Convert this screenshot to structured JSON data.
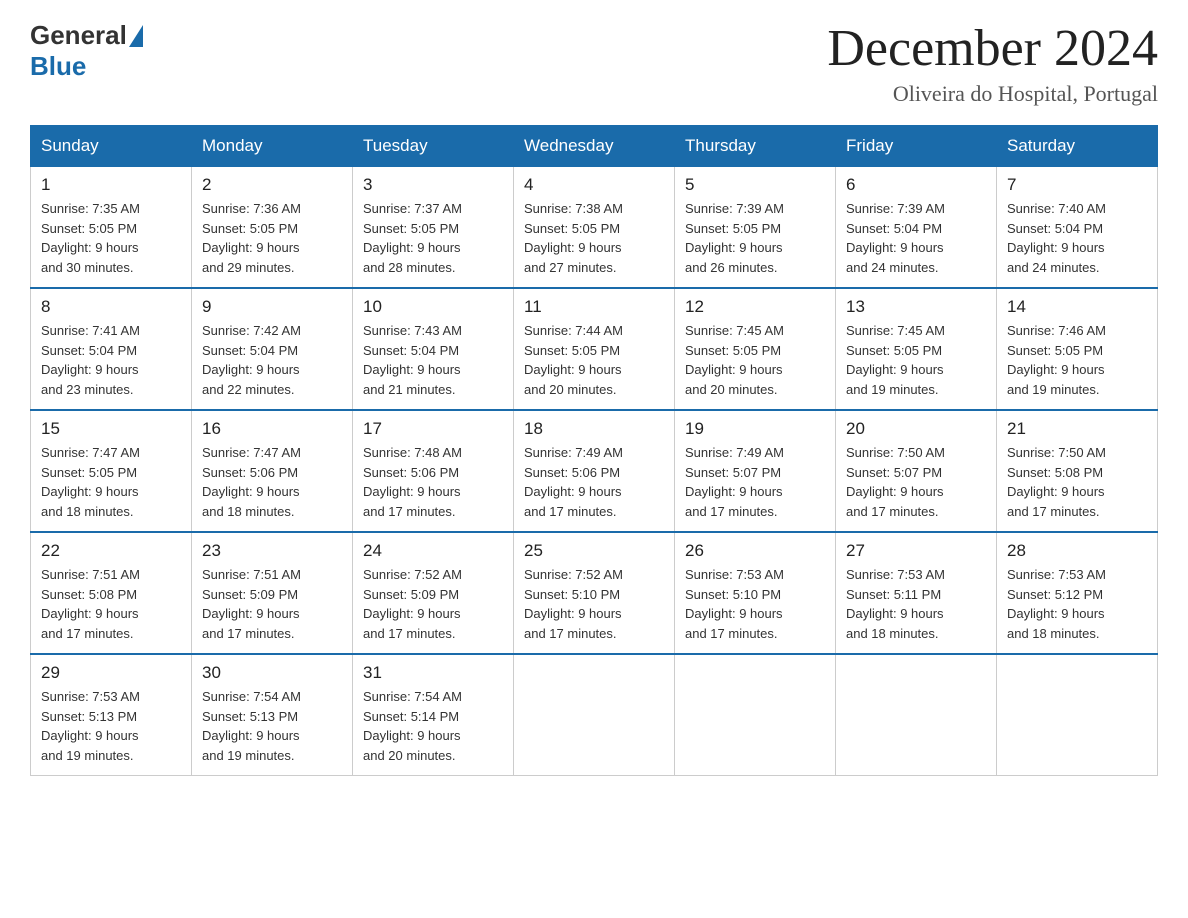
{
  "header": {
    "logo_text_general": "General",
    "logo_text_blue": "Blue",
    "month_title": "December 2024",
    "location": "Oliveira do Hospital, Portugal"
  },
  "weekdays": [
    "Sunday",
    "Monday",
    "Tuesday",
    "Wednesday",
    "Thursday",
    "Friday",
    "Saturday"
  ],
  "weeks": [
    [
      {
        "day": "1",
        "sunrise": "7:35 AM",
        "sunset": "5:05 PM",
        "daylight": "9 hours and 30 minutes."
      },
      {
        "day": "2",
        "sunrise": "7:36 AM",
        "sunset": "5:05 PM",
        "daylight": "9 hours and 29 minutes."
      },
      {
        "day": "3",
        "sunrise": "7:37 AM",
        "sunset": "5:05 PM",
        "daylight": "9 hours and 28 minutes."
      },
      {
        "day": "4",
        "sunrise": "7:38 AM",
        "sunset": "5:05 PM",
        "daylight": "9 hours and 27 minutes."
      },
      {
        "day": "5",
        "sunrise": "7:39 AM",
        "sunset": "5:05 PM",
        "daylight": "9 hours and 26 minutes."
      },
      {
        "day": "6",
        "sunrise": "7:39 AM",
        "sunset": "5:04 PM",
        "daylight": "9 hours and 24 minutes."
      },
      {
        "day": "7",
        "sunrise": "7:40 AM",
        "sunset": "5:04 PM",
        "daylight": "9 hours and 24 minutes."
      }
    ],
    [
      {
        "day": "8",
        "sunrise": "7:41 AM",
        "sunset": "5:04 PM",
        "daylight": "9 hours and 23 minutes."
      },
      {
        "day": "9",
        "sunrise": "7:42 AM",
        "sunset": "5:04 PM",
        "daylight": "9 hours and 22 minutes."
      },
      {
        "day": "10",
        "sunrise": "7:43 AM",
        "sunset": "5:04 PM",
        "daylight": "9 hours and 21 minutes."
      },
      {
        "day": "11",
        "sunrise": "7:44 AM",
        "sunset": "5:05 PM",
        "daylight": "9 hours and 20 minutes."
      },
      {
        "day": "12",
        "sunrise": "7:45 AM",
        "sunset": "5:05 PM",
        "daylight": "9 hours and 20 minutes."
      },
      {
        "day": "13",
        "sunrise": "7:45 AM",
        "sunset": "5:05 PM",
        "daylight": "9 hours and 19 minutes."
      },
      {
        "day": "14",
        "sunrise": "7:46 AM",
        "sunset": "5:05 PM",
        "daylight": "9 hours and 19 minutes."
      }
    ],
    [
      {
        "day": "15",
        "sunrise": "7:47 AM",
        "sunset": "5:05 PM",
        "daylight": "9 hours and 18 minutes."
      },
      {
        "day": "16",
        "sunrise": "7:47 AM",
        "sunset": "5:06 PM",
        "daylight": "9 hours and 18 minutes."
      },
      {
        "day": "17",
        "sunrise": "7:48 AM",
        "sunset": "5:06 PM",
        "daylight": "9 hours and 17 minutes."
      },
      {
        "day": "18",
        "sunrise": "7:49 AM",
        "sunset": "5:06 PM",
        "daylight": "9 hours and 17 minutes."
      },
      {
        "day": "19",
        "sunrise": "7:49 AM",
        "sunset": "5:07 PM",
        "daylight": "9 hours and 17 minutes."
      },
      {
        "day": "20",
        "sunrise": "7:50 AM",
        "sunset": "5:07 PM",
        "daylight": "9 hours and 17 minutes."
      },
      {
        "day": "21",
        "sunrise": "7:50 AM",
        "sunset": "5:08 PM",
        "daylight": "9 hours and 17 minutes."
      }
    ],
    [
      {
        "day": "22",
        "sunrise": "7:51 AM",
        "sunset": "5:08 PM",
        "daylight": "9 hours and 17 minutes."
      },
      {
        "day": "23",
        "sunrise": "7:51 AM",
        "sunset": "5:09 PM",
        "daylight": "9 hours and 17 minutes."
      },
      {
        "day": "24",
        "sunrise": "7:52 AM",
        "sunset": "5:09 PM",
        "daylight": "9 hours and 17 minutes."
      },
      {
        "day": "25",
        "sunrise": "7:52 AM",
        "sunset": "5:10 PM",
        "daylight": "9 hours and 17 minutes."
      },
      {
        "day": "26",
        "sunrise": "7:53 AM",
        "sunset": "5:10 PM",
        "daylight": "9 hours and 17 minutes."
      },
      {
        "day": "27",
        "sunrise": "7:53 AM",
        "sunset": "5:11 PM",
        "daylight": "9 hours and 18 minutes."
      },
      {
        "day": "28",
        "sunrise": "7:53 AM",
        "sunset": "5:12 PM",
        "daylight": "9 hours and 18 minutes."
      }
    ],
    [
      {
        "day": "29",
        "sunrise": "7:53 AM",
        "sunset": "5:13 PM",
        "daylight": "9 hours and 19 minutes."
      },
      {
        "day": "30",
        "sunrise": "7:54 AM",
        "sunset": "5:13 PM",
        "daylight": "9 hours and 19 minutes."
      },
      {
        "day": "31",
        "sunrise": "7:54 AM",
        "sunset": "5:14 PM",
        "daylight": "9 hours and 20 minutes."
      },
      null,
      null,
      null,
      null
    ]
  ],
  "labels": {
    "sunrise": "Sunrise:",
    "sunset": "Sunset:",
    "daylight": "Daylight:"
  }
}
